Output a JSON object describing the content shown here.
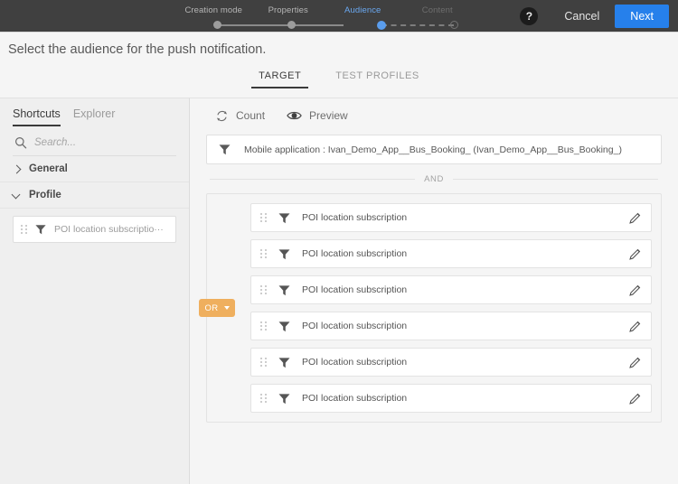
{
  "topbar": {
    "steps": [
      {
        "label": "Creation mode",
        "state": "done"
      },
      {
        "label": "Properties",
        "state": "done"
      },
      {
        "label": "Audience",
        "state": "active"
      },
      {
        "label": "Content",
        "state": "todo"
      }
    ],
    "help_icon": "help-icon",
    "cancel_label": "Cancel",
    "next_label": "Next",
    "accent_next": "#2680eb",
    "background": "#404040"
  },
  "page": {
    "title": "Select the audience for the push notification."
  },
  "main_tabs": [
    {
      "label": "TARGET",
      "active": true
    },
    {
      "label": "TEST PROFILES",
      "active": false
    }
  ],
  "sidebar": {
    "tabs": [
      {
        "label": "Shortcuts",
        "active": true
      },
      {
        "label": "Explorer",
        "active": false
      }
    ],
    "search": {
      "value": "",
      "placeholder": "Search...",
      "icon": "search-icon"
    },
    "groups": [
      {
        "label": "General",
        "expanded": false,
        "chevron": "chevron-right-icon"
      },
      {
        "label": "Profile",
        "expanded": true,
        "chevron": "chevron-down-icon"
      }
    ],
    "cards": [
      {
        "label": "POI location subscriptio···",
        "icon": "filter-icon",
        "handle": "drag-handle-icon"
      }
    ]
  },
  "toolbar": {
    "count_label": "Count",
    "count_icon": "refresh-icon",
    "preview_label": "Preview",
    "preview_icon": "eye-icon"
  },
  "query": {
    "root_filter": {
      "icon": "filter-icon",
      "text": "Mobile application : Ivan_Demo_App__Bus_Booking_  (Ivan_Demo_App__Bus_Booking_)"
    },
    "operator_and": "AND",
    "group": {
      "operator": "OR",
      "operator_color": "#efaf5e",
      "rules": [
        {
          "label": "POI location subscription",
          "icon": "filter-icon",
          "edit_icon": "pencil-icon",
          "handle": "drag-handle-icon"
        },
        {
          "label": "POI location subscription",
          "icon": "filter-icon",
          "edit_icon": "pencil-icon",
          "handle": "drag-handle-icon"
        },
        {
          "label": "POI location subscription",
          "icon": "filter-icon",
          "edit_icon": "pencil-icon",
          "handle": "drag-handle-icon"
        },
        {
          "label": "POI location subscription",
          "icon": "filter-icon",
          "edit_icon": "pencil-icon",
          "handle": "drag-handle-icon"
        },
        {
          "label": "POI location subscription",
          "icon": "filter-icon",
          "edit_icon": "pencil-icon",
          "handle": "drag-handle-icon"
        },
        {
          "label": "POI location subscription",
          "icon": "filter-icon",
          "edit_icon": "pencil-icon",
          "handle": "drag-handle-icon"
        }
      ]
    }
  }
}
